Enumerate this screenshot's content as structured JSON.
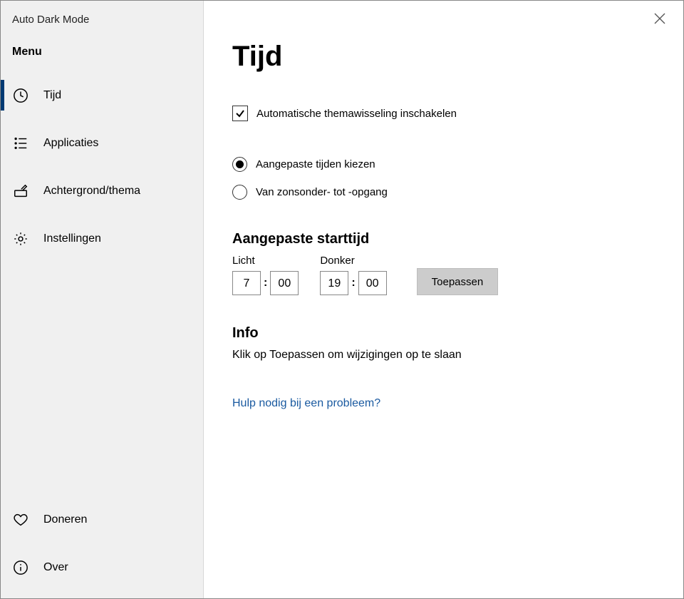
{
  "app_title": "Auto Dark Mode",
  "menu_title": "Menu",
  "sidebar": {
    "items": [
      {
        "icon": "clock-icon",
        "label": "Tijd",
        "active": true
      },
      {
        "icon": "list-icon",
        "label": "Applicaties",
        "active": false
      },
      {
        "icon": "paint-icon",
        "label": "Achtergrond/thema",
        "active": false
      },
      {
        "icon": "gear-icon",
        "label": "Instellingen",
        "active": false
      }
    ],
    "bottom": [
      {
        "icon": "heart-icon",
        "label": "Doneren"
      },
      {
        "icon": "info-icon",
        "label": "Over"
      }
    ]
  },
  "main": {
    "title": "Tijd",
    "enable_checkbox": {
      "label": "Automatische themawisseling inschakelen",
      "checked": true
    },
    "mode_radio": {
      "options": [
        {
          "label": "Aangepaste tijden kiezen",
          "checked": true
        },
        {
          "label": "Van zonsonder- tot -opgang",
          "checked": false
        }
      ]
    },
    "custom_start": {
      "heading": "Aangepaste starttijd",
      "light": {
        "label": "Licht",
        "hour": "7",
        "minute": "00"
      },
      "dark": {
        "label": "Donker",
        "hour": "19",
        "minute": "00"
      },
      "apply_label": "Toepassen"
    },
    "info": {
      "heading": "Info",
      "text": "Klik op Toepassen om wijzigingen op te slaan"
    },
    "help_link": "Hulp nodig bij een probleem?"
  }
}
